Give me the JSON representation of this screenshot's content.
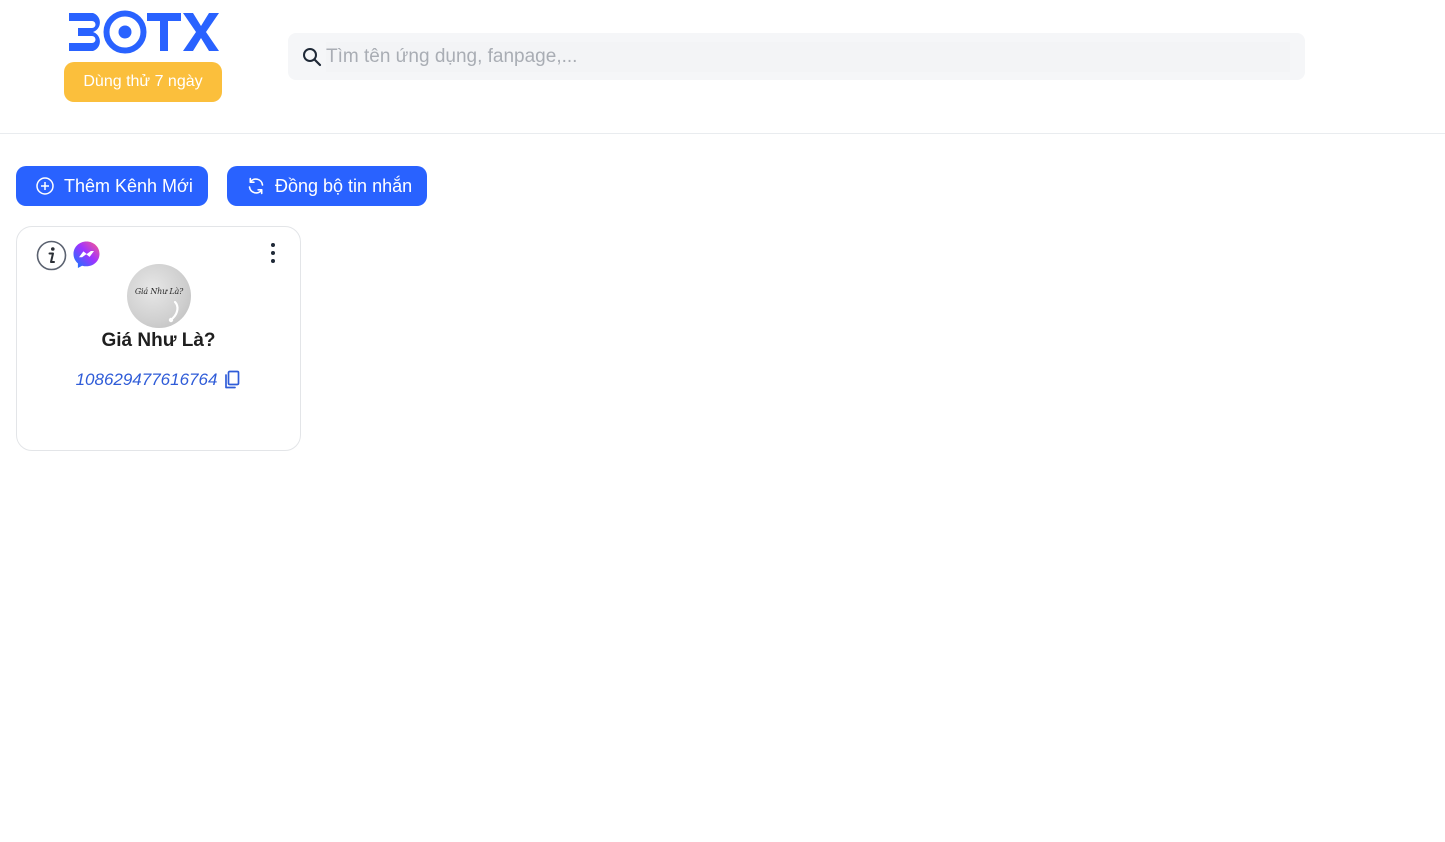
{
  "header": {
    "logo_text": "BOTX",
    "trial_label": "Dùng thử 7 ngày",
    "search": {
      "placeholder": "Tìm tên ứng dụng, fanpage,...",
      "value": "",
      "icon": "search-icon"
    }
  },
  "toolbar": {
    "add_channel_label": "Thêm Kênh Mới",
    "add_channel_icon": "plus-circle-icon",
    "sync_label": "Đồng bộ tin nhắn",
    "sync_icon": "refresh-icon"
  },
  "channels": [
    {
      "name": "Giá Như Là?",
      "id": "108629477616764",
      "platform": "messenger",
      "avatar_text": "Giá Như Là?",
      "icons": [
        "info-icon",
        "messenger-icon",
        "more-vertical-icon",
        "copy-icon"
      ]
    }
  ],
  "colors": {
    "primary": "#2962ff",
    "trial": "#fbbf3c",
    "link": "#2f5cd8"
  }
}
